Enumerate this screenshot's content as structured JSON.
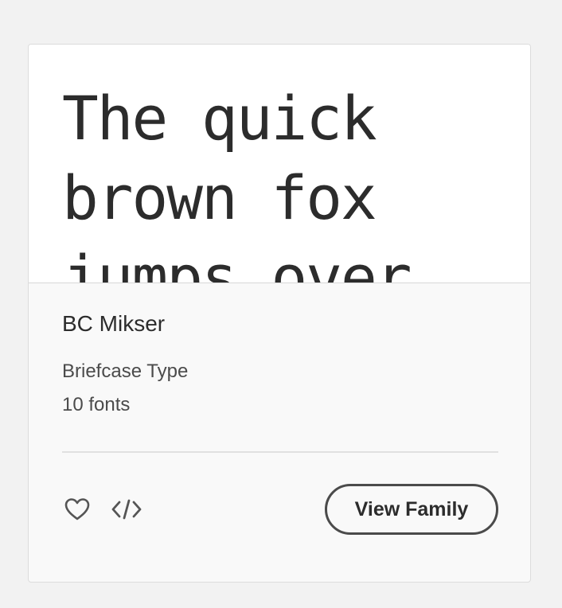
{
  "card": {
    "preview_text": "The quick brown fox jumps over",
    "family_name": "BC Mikser",
    "foundry": "Briefcase Type",
    "font_count": "10 fonts",
    "view_family_label": "View Family",
    "icons": {
      "favorite": "heart-icon",
      "embed": "code-icon"
    }
  }
}
